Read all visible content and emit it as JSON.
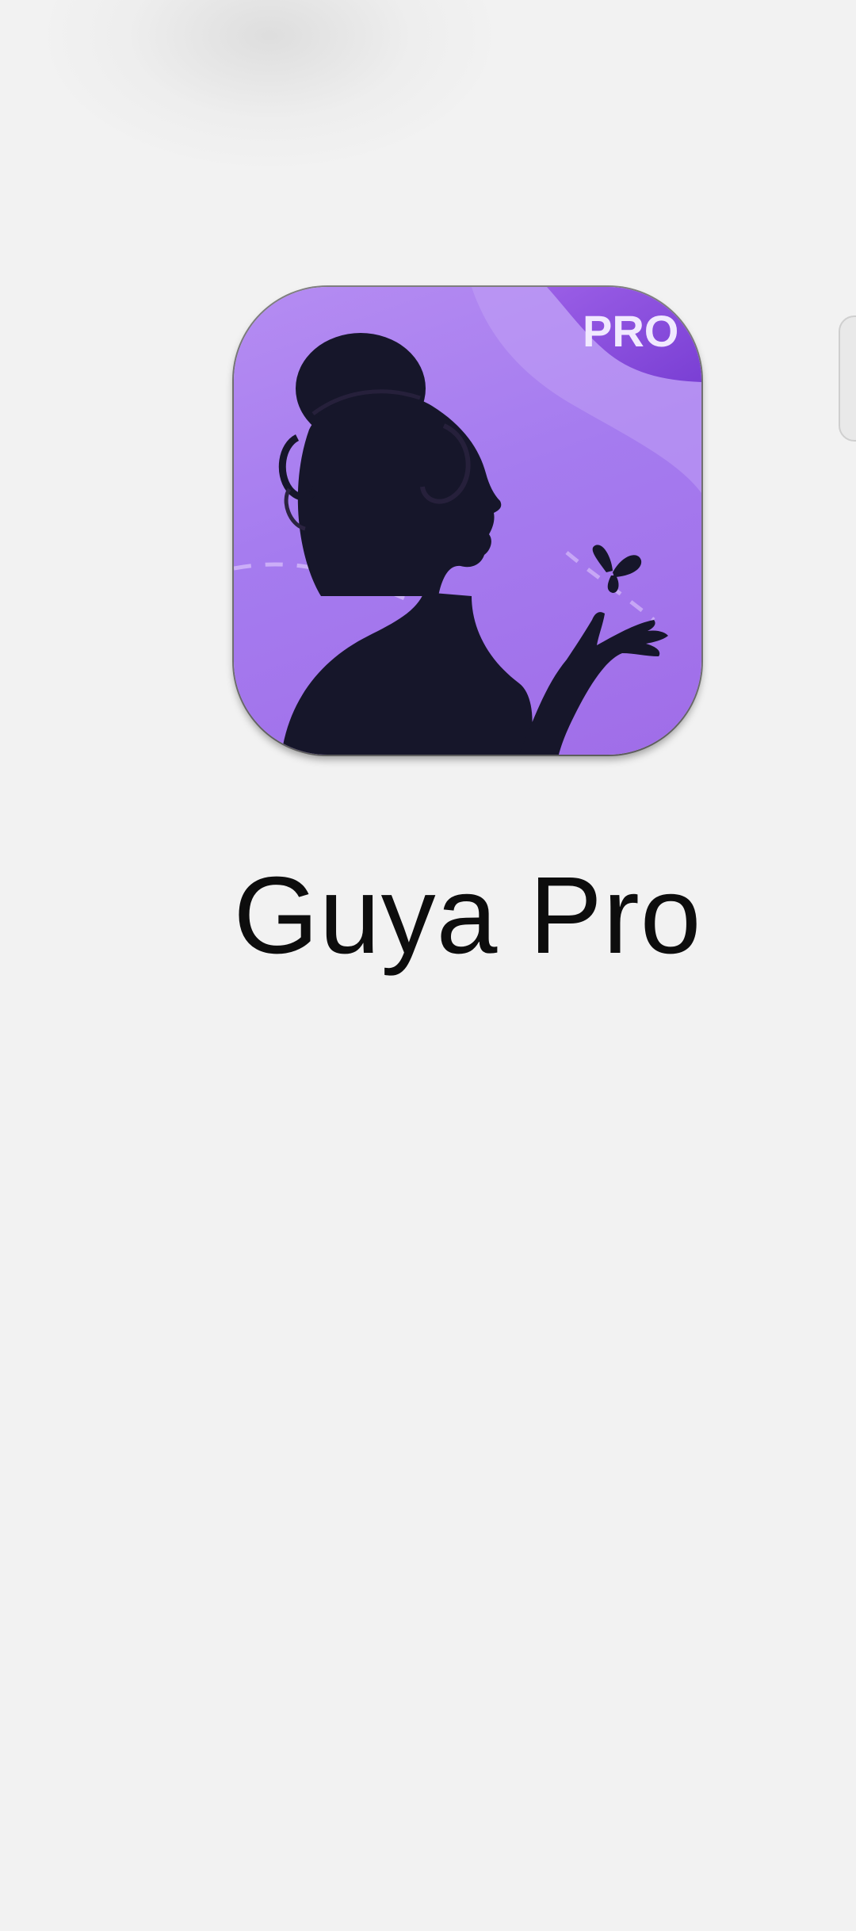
{
  "screen": {
    "background": "#f2f2f2"
  },
  "app": {
    "name": "Guya Pro",
    "icon": "woman-silhouette-butterfly-icon",
    "badge": "PRO",
    "icon_colors": {
      "light": "#b58cf2",
      "dark": "#7a3fd4",
      "silhouette": "#16162a"
    }
  }
}
